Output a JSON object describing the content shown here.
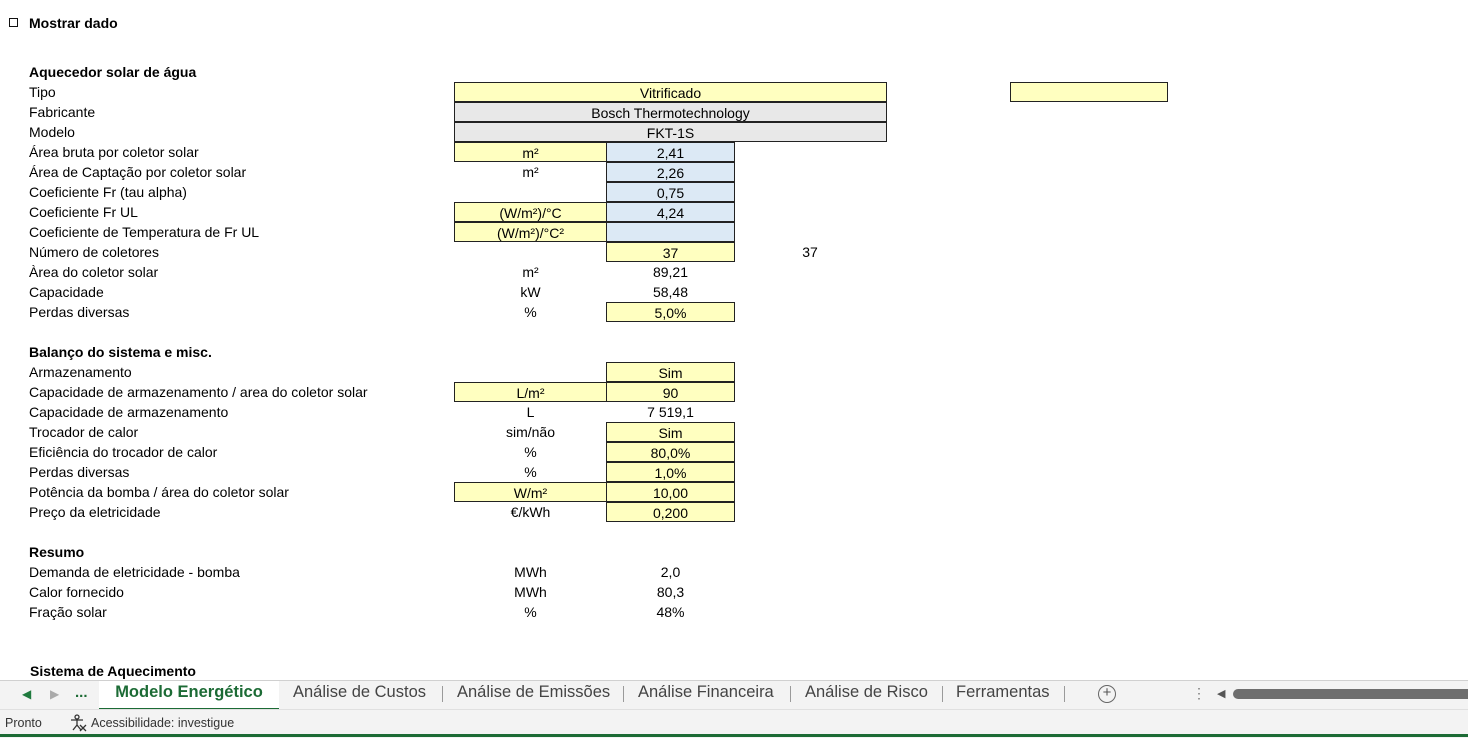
{
  "checkbox": {
    "label": "Mostrar dado"
  },
  "section1": {
    "title": "Aquecedor solar de água",
    "tipo": {
      "label": "Tipo",
      "value": "Vitrificado"
    },
    "fabricante": {
      "label": "Fabricante",
      "value": "Bosch Thermotechnology"
    },
    "modelo": {
      "label": "Modelo",
      "value": "FKT-1S"
    },
    "area_bruta": {
      "label": "Área bruta por coletor solar",
      "unit": "m²",
      "value": "2,41"
    },
    "area_captacao": {
      "label": "Área de Captação por coletor solar",
      "unit": "m²",
      "value": "2,26"
    },
    "fr_tau": {
      "label": "Coeficiente Fr (tau alpha)",
      "value": "0,75"
    },
    "fr_ul": {
      "label": "Coeficiente Fr UL",
      "unit": "(W/m²)/°C",
      "value": "4,24"
    },
    "temp_fr_ul": {
      "label": "Coeficiente de Temperatura de Fr UL",
      "unit": "(W/m²)/°C²",
      "value": ""
    },
    "num_coletores": {
      "label": "Número de coletores",
      "value": "37",
      "value2": "37"
    },
    "area_coletor": {
      "label": "Àrea do coletor solar",
      "unit": "m²",
      "value": "89,21"
    },
    "capacidade": {
      "label": "Capacidade",
      "unit": "kW",
      "value": "58,48"
    },
    "perdas": {
      "label": "Perdas diversas",
      "unit": "%",
      "value": "5,0%"
    }
  },
  "section2": {
    "title": "Balanço do sistema e misc.",
    "armazenamento": {
      "label": "Armazenamento",
      "value": "Sim"
    },
    "cap_area": {
      "label": "Capacidade de armazenamento / area do coletor solar",
      "unit": "L/m²",
      "value": "90"
    },
    "cap_arm": {
      "label": "Capacidade de armazenamento",
      "unit": "L",
      "value": "7 519,1"
    },
    "trocador": {
      "label": "Trocador de calor",
      "unit": "sim/não",
      "value": "Sim"
    },
    "eficiencia": {
      "label": "Eficiência do trocador de calor",
      "unit": "%",
      "value": "80,0%"
    },
    "perdas": {
      "label": "Perdas diversas",
      "unit": "%",
      "value": "1,0%"
    },
    "potencia": {
      "label": "Potência da bomba / área do coletor solar",
      "unit": "W/m²",
      "value": "10,00"
    },
    "preco": {
      "label": "Preço da eletricidade",
      "unit": "€/kWh",
      "value": "0,200"
    }
  },
  "section3": {
    "title": "Resumo",
    "demanda": {
      "label": "Demanda de eletricidade - bomba",
      "unit": "MWh",
      "value": "2,0"
    },
    "calor": {
      "label": "Calor fornecido",
      "unit": "MWh",
      "value": "80,3"
    },
    "fracao": {
      "label": "Fração solar",
      "unit": "%",
      "value": "48%"
    }
  },
  "section4": {
    "title": "Sistema de Aquecimento"
  },
  "tabs": {
    "ellipsis": "...",
    "items": [
      {
        "label": "Modelo Energético"
      },
      {
        "label": "Análise de Custos"
      },
      {
        "label": "Análise de Emissões"
      },
      {
        "label": "Análise Financeira"
      },
      {
        "label": "Análise de Risco"
      },
      {
        "label": "Ferramentas"
      }
    ],
    "add": "+"
  },
  "status": {
    "ready": "Pronto",
    "accessibility": "Acessibilidade: investigue"
  },
  "colors": {
    "input_yellow": "#ffffc0",
    "calc_blue": "#dce9f5",
    "fixed_gray": "#e8e8e8",
    "accent_green": "#1c6b35"
  }
}
